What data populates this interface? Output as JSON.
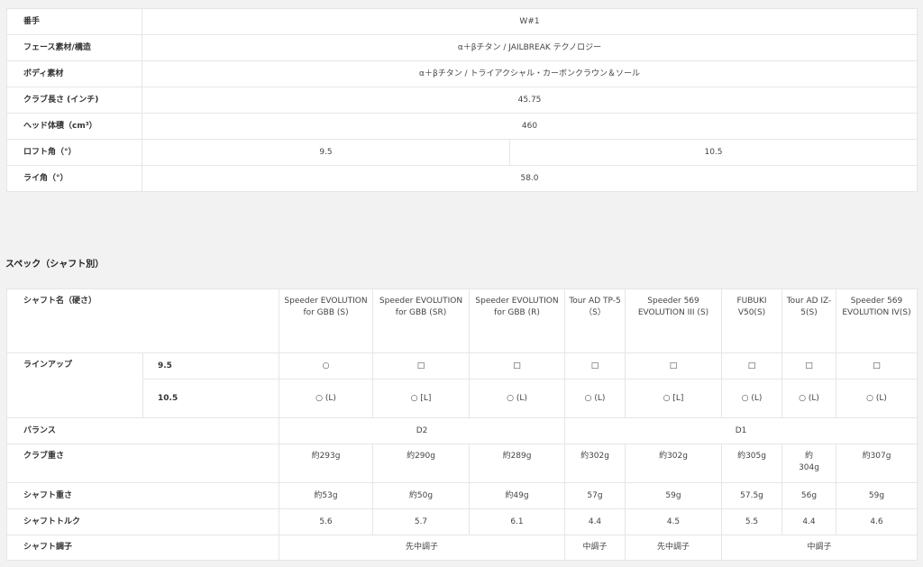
{
  "spec": {
    "rows": [
      {
        "label": "番手",
        "value": "W#1"
      },
      {
        "label": "フェース素材/構造",
        "value": "α＋βチタン / JAILBREAK テクノロジー"
      },
      {
        "label": "ボディ素材",
        "value": "α＋βチタン / トライアクシャル・カーボンクラウン＆ソール"
      },
      {
        "label": "クラブ長さ (インチ)",
        "value": "45.75"
      },
      {
        "label": "ヘッド体積（cm³）",
        "value": "460"
      },
      {
        "label": "ロフト角（°）",
        "values": [
          "9.5",
          "10.5"
        ]
      },
      {
        "label": "ライ角（°）",
        "value": "58.0"
      }
    ]
  },
  "section_title": "スペック（シャフト別）",
  "shaft": {
    "header_label": "シャフト名（硬さ）",
    "shafts": [
      "Speeder EVOLUTION for GBB (S)",
      "Speeder EVOLUTION for GBB (SR)",
      "Speeder EVOLUTION for GBB (R)",
      "Tour AD TP-5（S）",
      "Speeder 569 EVOLUTION III (S)",
      "FUBUKI V50(S)",
      "Tour AD IZ-5(S)",
      "Speeder 569 EVOLUTION IV(S)"
    ],
    "lineup_label": "ラインアップ",
    "lineup": [
      {
        "loft": "9.5",
        "marks": [
          "○",
          "□",
          "□",
          "□",
          "□",
          "□",
          "□",
          "□"
        ]
      },
      {
        "loft": "10.5",
        "marks": [
          "○ (L)",
          "○ [L]",
          "○ (L)",
          "○ (L)",
          "○ [L]",
          "○ (L)",
          "○ (L)",
          "○ (L)"
        ]
      }
    ],
    "balance_label": "バランス",
    "balance": [
      "D2",
      "D1"
    ],
    "club_weight_label": "クラブ重さ",
    "club_weight": [
      "約293g",
      "約290g",
      "約289g",
      "約302g",
      "約302g",
      "約305g",
      "約 304g",
      "約307g"
    ],
    "shaft_weight_label": "シャフト重さ",
    "shaft_weight": [
      "約53g",
      "約50g",
      "約49g",
      "57g",
      "59g",
      "57.5g",
      "56g",
      "59g"
    ],
    "torque_label": "シャフトトルク",
    "torque": [
      "5.6",
      "5.7",
      "6.1",
      "4.4",
      "4.5",
      "5.5",
      "4.4",
      "4.6"
    ],
    "kick_label": "シャフト調子",
    "kick": [
      "先中調子",
      "中調子",
      "先中調子",
      "中調子"
    ]
  }
}
